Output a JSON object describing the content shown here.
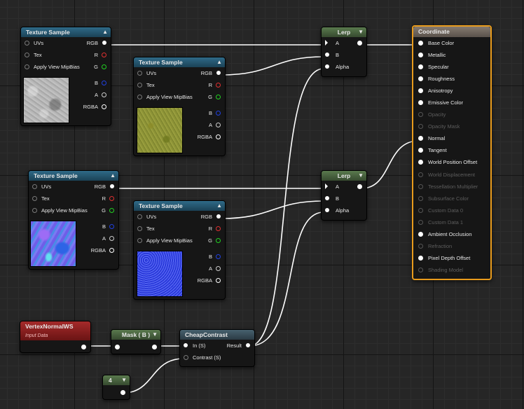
{
  "colors": {
    "background": "#262626",
    "texture_header": "#2f6a88",
    "constant_header": "#5a7a4e",
    "function_header": "#47616e",
    "material_header": "#857a70",
    "input_data_header": "#a52a2a",
    "selection_outline": "#e89b1c",
    "pin_r": "#e03030",
    "pin_g": "#22d022",
    "pin_b": "#2040e0"
  },
  "nodes": {
    "tex1": {
      "title": "Texture Sample",
      "inputs": [
        "UVs",
        "Tex",
        "Apply View MipBias"
      ],
      "outputs": [
        "RGB",
        "R",
        "G",
        "B",
        "A",
        "RGBA"
      ],
      "thumbnail": "gray-noise-texture"
    },
    "tex2": {
      "title": "Texture Sample",
      "inputs": [
        "UVs",
        "Tex",
        "Apply View MipBias"
      ],
      "outputs": [
        "RGB",
        "R",
        "G",
        "B",
        "A",
        "RGBA"
      ],
      "thumbnail": "yellow-noise-texture"
    },
    "tex3": {
      "title": "Texture Sample",
      "inputs": [
        "UVs",
        "Tex",
        "Apply View MipBias"
      ],
      "outputs": [
        "RGB",
        "R",
        "G",
        "B",
        "A",
        "RGBA"
      ],
      "thumbnail": "blue-normal-map-texture"
    },
    "tex4": {
      "title": "Texture Sample",
      "inputs": [
        "UVs",
        "Tex",
        "Apply View MipBias"
      ],
      "outputs": [
        "RGB",
        "R",
        "G",
        "B",
        "A",
        "RGBA"
      ],
      "thumbnail": "blue-fine-normal-map-texture"
    },
    "lerp1": {
      "title": "Lerp",
      "inputs": [
        "A",
        "B",
        "Alpha"
      ]
    },
    "lerp2": {
      "title": "Lerp",
      "inputs": [
        "A",
        "B",
        "Alpha"
      ]
    },
    "vertex": {
      "title": "VertexNormalWS",
      "subtitle": "Input Data"
    },
    "mask": {
      "title": "Mask ( B )"
    },
    "contrast": {
      "title": "CheapContrast",
      "inputs": [
        "In (S)",
        "Contrast (S)"
      ],
      "output": "Result"
    },
    "const4": {
      "title": "4"
    },
    "material": {
      "title": "Coordinate",
      "pins": [
        {
          "label": "Base Color",
          "enabled": true
        },
        {
          "label": "Metallic",
          "enabled": true
        },
        {
          "label": "Specular",
          "enabled": true
        },
        {
          "label": "Roughness",
          "enabled": true
        },
        {
          "label": "Anisotropy",
          "enabled": true
        },
        {
          "label": "Emissive Color",
          "enabled": true
        },
        {
          "label": "Opacity",
          "enabled": false
        },
        {
          "label": "Opacity Mask",
          "enabled": false
        },
        {
          "label": "Normal",
          "enabled": true
        },
        {
          "label": "Tangent",
          "enabled": true
        },
        {
          "label": "World Position Offset",
          "enabled": true
        },
        {
          "label": "World Displacement",
          "enabled": false
        },
        {
          "label": "Tessellation Multiplier",
          "enabled": false
        },
        {
          "label": "Subsurface Color",
          "enabled": false
        },
        {
          "label": "Custom Data 0",
          "enabled": false
        },
        {
          "label": "Custom Data 1",
          "enabled": false
        },
        {
          "label": "Ambient Occlusion",
          "enabled": true
        },
        {
          "label": "Refraction",
          "enabled": false
        },
        {
          "label": "Pixel Depth Offset",
          "enabled": true
        },
        {
          "label": "Shading Model",
          "enabled": false
        }
      ]
    }
  }
}
